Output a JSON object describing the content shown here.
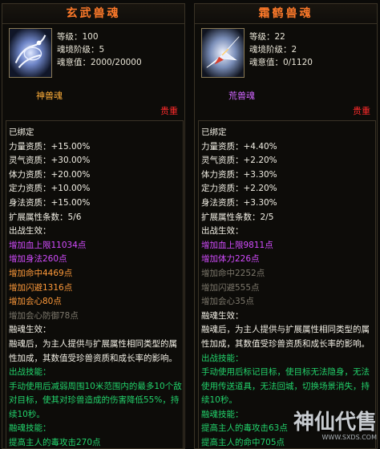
{
  "left": {
    "title": "玄武兽魂",
    "level": "等级：100",
    "realm": "魂境阶级：5",
    "soul_power": "魂意值：2000/20000",
    "soul_type": "神兽魂",
    "rarity": "贵重",
    "lines": [
      {
        "text": "已绑定",
        "color": "white"
      },
      {
        "text": "力量资质：+15.00%",
        "color": "white"
      },
      {
        "text": "灵气资质：+30.00%",
        "color": "white"
      },
      {
        "text": "体力资质：+20.00%",
        "color": "white"
      },
      {
        "text": "定力资质：+10.00%",
        "color": "white"
      },
      {
        "text": "身法资质：+15.00%",
        "color": "white"
      },
      {
        "text": "扩展属性条数：5/6",
        "color": "white"
      },
      {
        "text": "出战生效：",
        "color": "white"
      },
      {
        "text": "增加血上限11034点",
        "color": "purple"
      },
      {
        "text": "增加身法260点",
        "color": "purple"
      },
      {
        "text": "增加命中4469点",
        "color": "orange"
      },
      {
        "text": "增加闪避1316点",
        "color": "orange"
      },
      {
        "text": "增加会心80点",
        "color": "orange"
      },
      {
        "text": "增加会心防御78点",
        "color": "gray"
      },
      {
        "text": "融魂生效：",
        "color": "white"
      },
      {
        "text": "融魂后，为主人提供与扩展属性相同类型的属性加成，其数值受珍兽资质和成长率的影响。",
        "color": "white",
        "wrap": true
      },
      {
        "text": "出战技能：",
        "color": "green"
      },
      {
        "text": "手动使用后减弱周围10米范围内的最多10个敌对目标，使其对珍兽造成的伤害降低55%，持续10秒。",
        "color": "green",
        "wrap": true
      },
      {
        "text": "融魂技能：",
        "color": "green"
      },
      {
        "text": "提高主人的毒攻击270点",
        "color": "green"
      }
    ]
  },
  "right": {
    "title": "霜鹤兽魂",
    "level": "等级：22",
    "realm": "魂境阶级：2",
    "soul_power": "魂意值：0/1120",
    "soul_type": "荒兽魂",
    "rarity": "贵重",
    "lines": [
      {
        "text": "已绑定",
        "color": "white"
      },
      {
        "text": "力量资质：+4.40%",
        "color": "white"
      },
      {
        "text": "灵气资质：+2.20%",
        "color": "white"
      },
      {
        "text": "体力资质：+3.30%",
        "color": "white"
      },
      {
        "text": "定力资质：+2.20%",
        "color": "white"
      },
      {
        "text": "身法资质：+3.30%",
        "color": "white"
      },
      {
        "text": "扩展属性条数：2/5",
        "color": "white"
      },
      {
        "text": "出战生效：",
        "color": "white"
      },
      {
        "text": "增加血上限9811点",
        "color": "purple"
      },
      {
        "text": "增加体力226点",
        "color": "purple"
      },
      {
        "text": "增加命中2252点",
        "color": "gray"
      },
      {
        "text": "增加闪避555点",
        "color": "gray"
      },
      {
        "text": "增加会心35点",
        "color": "gray"
      },
      {
        "text": "融魂生效：",
        "color": "white"
      },
      {
        "text": "融魂后，为主人提供与扩展属性相同类型的属性加成，其数值受珍兽资质和成长率的影响。",
        "color": "white",
        "wrap": true
      },
      {
        "text": "出战技能：",
        "color": "green"
      },
      {
        "text": "手动使用后标记目标，使目标无法隐身，无法使用传送道具，无法回城，切换场景消失，持续10秒。",
        "color": "green",
        "wrap": true
      },
      {
        "text": "融魂技能：",
        "color": "green"
      },
      {
        "text": "提高主人的毒攻击63点",
        "color": "green"
      },
      {
        "text": "提高主人的命中705点",
        "color": "green"
      }
    ]
  },
  "watermark": {
    "text": "神仙代售",
    "url": "WWW.SXDS.COM"
  },
  "colors": {
    "white": "#f2efe5",
    "purple": "#d34cff",
    "orange": "#ff9a3a",
    "gray": "#7d786c",
    "green": "#22d26b",
    "title": "#ff7a2a",
    "rarity": "#ff2a2a"
  }
}
